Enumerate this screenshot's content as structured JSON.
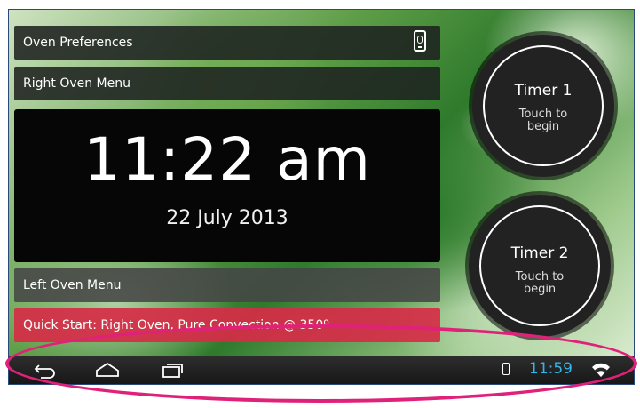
{
  "menu": {
    "oven_preferences": "Oven Preferences",
    "right_oven_menu": "Right Oven Menu",
    "left_oven_menu": "Left Oven Menu",
    "quick_start": "Quick Start: Right Oven, Pure Convection @ 350º"
  },
  "clock": {
    "time": "11:22 am",
    "date": "22 July 2013"
  },
  "timers": [
    {
      "title": "Timer 1",
      "subtitle": "Touch to begin"
    },
    {
      "title": "Timer 2",
      "subtitle": "Touch to begin"
    }
  ],
  "status_bar": {
    "time": "11:59",
    "time_color": "#33b5e5"
  },
  "icons": {
    "preferences": "phone-icon",
    "back": "back-icon",
    "home": "home-icon",
    "recents": "recents-icon",
    "status_device": "phone-status-icon",
    "wifi": "wifi-icon"
  },
  "colors": {
    "quick_start_bg": "#d62c46",
    "highlight": "#e0217a"
  }
}
